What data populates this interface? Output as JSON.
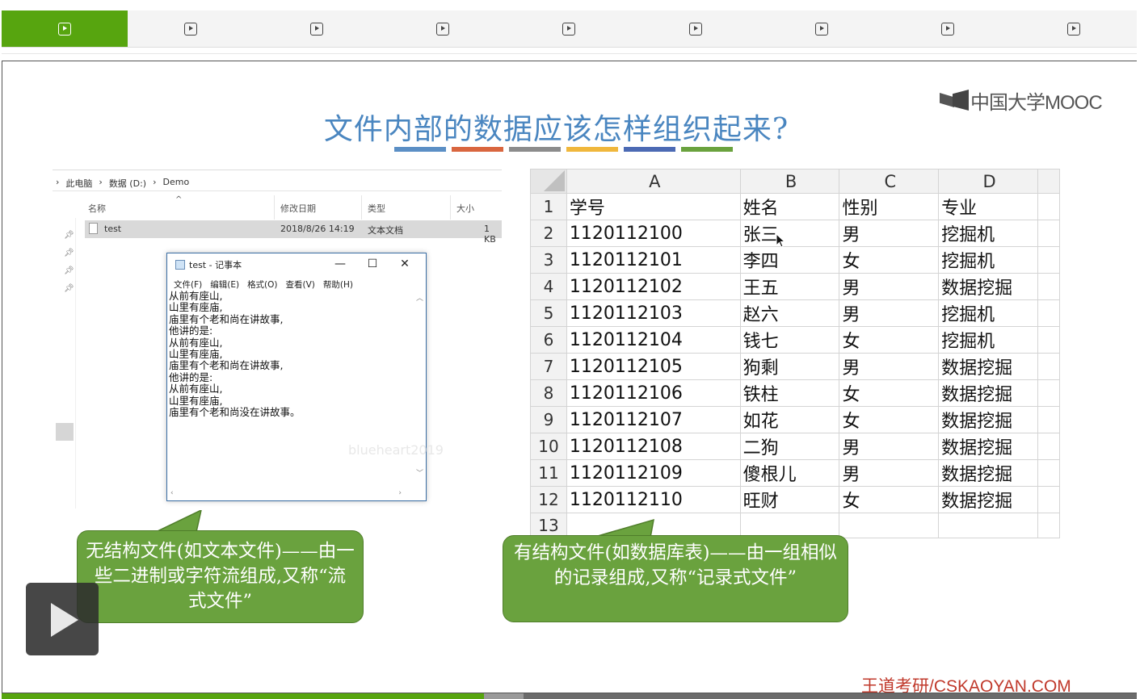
{
  "tabs": {
    "count": 9,
    "active_index": 0
  },
  "slide": {
    "title": "文件内部的数据应该怎样组织起来?",
    "brand_logo_text": "中国大学MOOC",
    "color_bar_colors": [
      "#5b8fc5",
      "#d9663f",
      "#8c8c8c",
      "#f0b73c",
      "#4c6ab4",
      "#6aa23e"
    ]
  },
  "explorer": {
    "breadcrumb": [
      "此电脑",
      "数据 (D:)",
      "Demo"
    ],
    "columns": {
      "name": "名称",
      "modified": "修改日期",
      "type": "类型",
      "size": "大小"
    },
    "file": {
      "name": "test",
      "modified": "2018/8/26 14:19",
      "type": "文本文档",
      "size": "1 KB"
    }
  },
  "notepad": {
    "title": "test - 记事本",
    "menu": [
      "文件(F)",
      "编辑(E)",
      "格式(O)",
      "查看(V)",
      "帮助(H)"
    ],
    "content": "从前有座山,\n山里有座庙,\n庙里有个老和尚在讲故事,\n他讲的是:\n从前有座山,\n山里有座庙,\n庙里有个老和尚在讲故事,\n他讲的是:\n从前有座山,\n山里有座庙,\n庙里有个老和尚没在讲故事。",
    "watermark": "blueheart2019"
  },
  "callouts": {
    "left": "无结构文件(如文本文件)——由一些二进制或字符流组成,又称“流式文件”",
    "right": "有结构文件(如数据库表)——由一组相似的记录组成,又称“记录式文件”"
  },
  "spreadsheet": {
    "columns": [
      "A",
      "B",
      "C",
      "D"
    ],
    "rows": [
      [
        "学号",
        "姓名",
        "性别",
        "专业"
      ],
      [
        "1120112100",
        "张三",
        "男",
        "挖掘机"
      ],
      [
        "1120112101",
        "李四",
        "女",
        "挖掘机"
      ],
      [
        "1120112102",
        "王五",
        "男",
        "数据挖掘"
      ],
      [
        "1120112103",
        "赵六",
        "男",
        "挖掘机"
      ],
      [
        "1120112104",
        "钱七",
        "女",
        "挖掘机"
      ],
      [
        "1120112105",
        "狗剩",
        "男",
        "数据挖掘"
      ],
      [
        "1120112106",
        "铁柱",
        "女",
        "数据挖掘"
      ],
      [
        "1120112107",
        "如花",
        "女",
        "数据挖掘"
      ],
      [
        "1120112108",
        "二狗",
        "男",
        "数据挖掘"
      ],
      [
        "1120112109",
        "傻根儿",
        "男",
        "数据挖掘"
      ],
      [
        "1120112110",
        "旺财",
        "女",
        "数据挖掘"
      ],
      [
        "",
        "",
        "",
        ""
      ]
    ]
  },
  "footer": {
    "brand": "王道考研/CSKAOYAN.COM"
  },
  "player": {
    "progress_fraction": 0.425,
    "buffered_fraction": 0.46
  }
}
